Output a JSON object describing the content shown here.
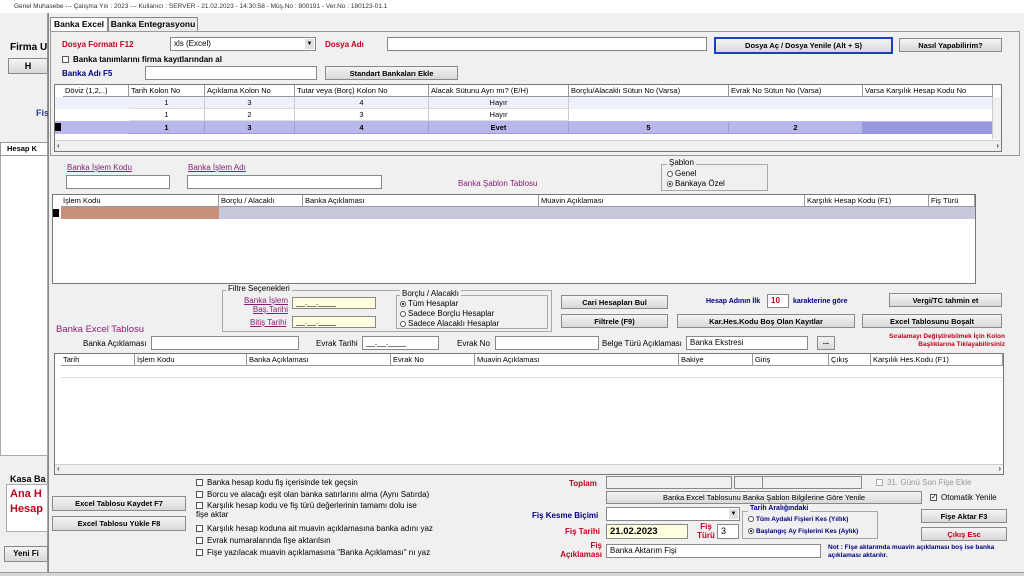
{
  "window": {
    "title": "Genel Muhasebe  ---  Çalışma Yılı : 2023  ---  Kullanıcı : SERVER  -  21.02.2023 - 14:30:58  -  Müş.No : 800191  -  Ver.No : 180123-01.1"
  },
  "background": {
    "firma_label": "Firma U",
    "button_h": "H",
    "fis_label": "Fis",
    "hesap_label": "Hesap K",
    "kasa_label": "Kasa Ba",
    "ana_text": "Ana H",
    "hesap_text": "Hesap",
    "yeni_label": "Yeni Fi"
  },
  "tabs": [
    {
      "label": "Banka Excel"
    },
    {
      "label": "Banka Entegrasyonu"
    }
  ],
  "top": {
    "dosya_formati_label": "Dosya Formatı F12",
    "dosya_formati_value": "xls (Excel)",
    "dosya_adi_label": "Dosya Adı",
    "dosya_adi_value": "",
    "dosya_ac_button": "Dosya Aç / Dosya Yenile (Alt + S)",
    "nasil_button": "Nasıl Yapabilirim?",
    "banka_tanim_checkbox": "Banka tanımlarını firma kayıtlarından al",
    "banka_adi_label": "Banka Adı F5",
    "banka_adi_value": "",
    "standart_button": "Standart Bankaları Ekle"
  },
  "format_table": {
    "headers": [
      "Döviz (1,2,..)",
      "Tarih Kolon No",
      "Açıklama Kolon No",
      "Tutar veya (Borç) Kolon No",
      "Alacak Sütunu Ayrı mı? (E/H)",
      "Borçlu/Alacaklı Sütun No (Varsa)",
      "Evrak No Sütun No (Varsa)",
      "Varsa Karşılık Hesap Kodu No"
    ],
    "rows": [
      [
        "",
        "1",
        "3",
        "4",
        "Hayır",
        "",
        "",
        ""
      ],
      [
        "",
        "1",
        "2",
        "3",
        "Hayır",
        "",
        "",
        ""
      ],
      [
        "",
        "1",
        "3",
        "4",
        "Evet",
        "5",
        "2",
        ""
      ]
    ]
  },
  "islem": {
    "kodu_label": "Banka İşlem Kodu",
    "adi_label": "Banka İşlem Adı",
    "sablon_tablosu_label": "Banka Şablon Tablosu",
    "sablon_group": "Şablon",
    "sablon_genel": "Genel",
    "sablon_ozel": "Bankaya Özel"
  },
  "sablon_table": {
    "headers": [
      "İşlem Kodu",
      "Borçlu / Alacaklı",
      "Banka Açıklaması",
      "Muavin Açıklaması",
      "Karşılık Hesap Kodu (F1)",
      "Fiş Türü"
    ]
  },
  "filtre": {
    "group_label": "Filtre Seçenekleri",
    "bas_tarihi_label": "Banka İşlem Baş.Tarihi",
    "bitis_tarihi_label": "Bitiş Tarihi",
    "date_placeholder": "__.__.____",
    "borclu_group": "Borçlu / Alacaklı",
    "tum_hesaplar": "Tüm Hesaplar",
    "sadece_borclu": "Sadece Borçlu Hesaplar",
    "sadece_alacakli": "Sadece Alacaklı Hesaplar",
    "cari_button": "Cari Hesapları Bul",
    "filtrele_button": "Filtrele (F9)",
    "hesap_adinin_label": "Hesap Adının  İlk",
    "hesap_adinin_value": "10",
    "karakterine_label": "karakterine göre",
    "kar_hes_button": "Kar.Hes.Kodu Boş Olan Kayıtlar",
    "vergi_button": "Vergi/TC tahmin et",
    "bosalt_button": "Excel Tablosunu Boşalt"
  },
  "excel_table_section": {
    "title": "Banka Excel Tablosu",
    "banka_aciklamasi_label": "Banka Açıklaması",
    "evrak_tarihi_label": "Evrak Tarihi",
    "evrak_no_label": "Evrak No",
    "belge_turu_label": "Belge Türü Açıklaması",
    "belge_turu_value": "Banka Ekstresi",
    "dots_button": "...",
    "note": "Sıralamayı Değiştirebilmek İçin Kolon Başlıklarına Tıklayabilirsiniz",
    "headers": [
      "Tarih",
      "İşlem Kodu",
      "Banka Açıklaması",
      "Evrak No",
      "Muavin Açıklaması",
      "Bakiye",
      "Giriş",
      "Çıkış",
      "Karşılık Hes.Kodu (F1)"
    ]
  },
  "bottom": {
    "kaydet_button": "Excel Tablosu Kaydet F7",
    "yukle_button": "Excel Tablosu Yükle F8",
    "options": [
      "Banka hesap kodu fiş içerisinde tek geçsin",
      "Borcu ve alacağı eşit olan banka satırlarını alma (Aynı Satırda)",
      "Karşılık hesap kodu ve fiş türü değerlerinin tamamı dolu ise fişe aktar",
      "Karşılık hesap koduna ait muavin açıklamasına banka adını yaz",
      "Evrak numaralarında fişe aktarılsın",
      "Fişe yazılacak muavin açıklamasına \"Banka Açıklaması\" nı yaz"
    ],
    "toplam_label": "Toplam",
    "gun_son_label": "31. Günü Son Fişe Ekle",
    "sablon_yenile_button": "Banka Excel Tablosunu Banka Şablon Bilgilerine Göre Yenile",
    "otomatik_yenile": "Otomatik Yenile",
    "fis_kesme_label": "Fiş Kesme Biçimi",
    "fis_kesme_value": "",
    "tarih_group": "Tarih Aralığındaki",
    "tum_aydaki": "Tüm Aydaki Fişleri Kes (Yıllık)",
    "baslangic_ay": "Başlangıç Ay Fişlerini Kes (Aylık)",
    "fise_aktar_button": "Fişe Aktar F3",
    "cikis_button": "Çıkış Esc",
    "fis_tarihi_label": "Fiş Tarihi",
    "fis_tarihi_value": "21.02.2023",
    "fis_turu_label": "Fiş Türü",
    "fis_turu_value": "3",
    "fis_aciklamasi_label": "Fiş Açıklaması",
    "fis_aciklamasi_value": "Banka Aktarım Fişi",
    "note": "Not : Fişe aktarımda muavin açıklaması boş ise banka açıklaması aktarılır."
  }
}
